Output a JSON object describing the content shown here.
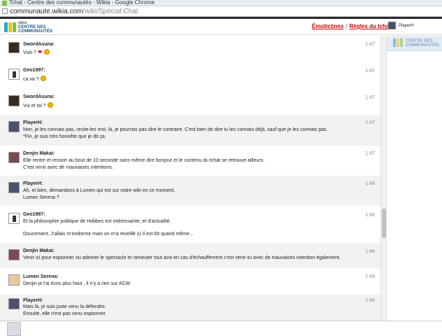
{
  "browser": {
    "tab_title": "Tchat - Centre des communautés - Wikia - Google Chrome",
    "url_host": "communaute.wikia.com",
    "url_path": "/wiki/Spécial:Chat"
  },
  "header": {
    "logo_small": "wikia",
    "logo_big_1": "CENTRE DES",
    "logo_big_2": "COMMUNAUTÉS",
    "emoticons_link": "Émoticônes",
    "separator": "/",
    "rules_link": "Règles du tchat",
    "current_user": "PlayerH"
  },
  "colors": {
    "accent_link": "#cc0000",
    "logo_blue": "#1b4f8a",
    "logo_green": "#7bc142",
    "logo_yellow": "#f4c20d",
    "logo_cyan": "#25a7d9",
    "alt_row": "#f2f2f2"
  },
  "messages": [
    {
      "user": "SwordAsuna:",
      "time": "1:47",
      "lines": [
        "Vuiii ?"
      ],
      "emotes": [
        "heart",
        "smile"
      ]
    },
    {
      "user": "Geo1997:",
      "time": "1:47",
      "lines": [
        "ca va ?"
      ],
      "emotes": [
        "smile"
      ]
    },
    {
      "user": "SwordAsuna:",
      "time": "1:47",
      "lines": [
        "Vui et toi ?"
      ],
      "emotes": [
        "smile"
      ]
    },
    {
      "user": "PlayerH:",
      "time": "1:47",
      "lines": [
        "Non, je les connais pas, recite-les moi, là, je pourrais pas dire le contraire. C'est bien de dire tu les connais déjà, sauf que je les connais pas.",
        "*Fin, je suis très honnête que je dit ça."
      ]
    },
    {
      "user": "Denjin Makai:",
      "time": "1:47",
      "lines": [
        "Elle rentre et ressort au bout de 10 seconde sans même dire bonjour et le contenu du tchat se retrouve ailleurs.",
        "C'est venir avec de mauvaises intentions."
      ]
    },
    {
      "user": "PlayerH:",
      "time": "1:48",
      "lines": [
        "Ah, et bien, demandons à Lumen qui est sur notre wiki en ce moment.",
        "Lumen Serena ?"
      ]
    },
    {
      "user": "Geo1997:",
      "time": "1:48",
      "lines": [
        "Et la philosophie politique de Hobbes est intéressante, et d'actualité.",
        "Doucement. J'allais m'endormir mais on m'a réveillé x) Il est tôt quand même..."
      ]
    },
    {
      "user": "Denjin Makai:",
      "time": "1:48",
      "lines": [
        "Venir ici pour espionner ou admirer le spectacle et rameuter tout acw en cas d'échauffement c'est venir ici avec de mauvaises intention également."
      ]
    },
    {
      "user": "Lumen Serena:",
      "time": "1:49",
      "lines": [
        "Denjin je l'ai écris plus haut , il n'y a rien sur ACW"
      ]
    },
    {
      "user": "PlayerH:",
      "time": "1:49",
      "lines": [
        "Mais là, je suis juste venu la défendre.",
        "Ensuite, elle n'est pas venu espionner."
      ]
    }
  ],
  "input": {
    "placeholder": ""
  }
}
